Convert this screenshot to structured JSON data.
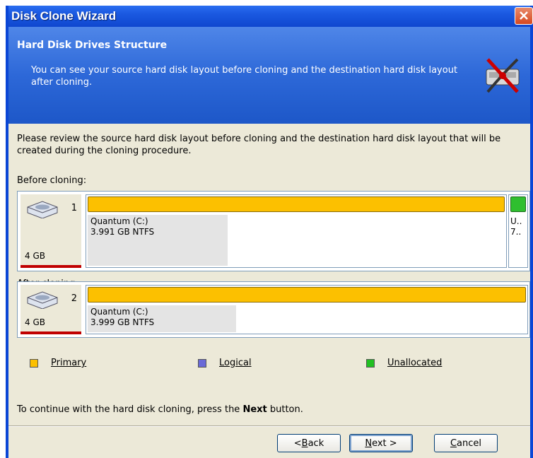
{
  "window": {
    "title": "Disk Clone Wizard"
  },
  "header": {
    "title": "Hard Disk Drives Structure",
    "description": "You can see your source hard disk layout before cloning and the destination hard disk layout after cloning."
  },
  "intro": "Please review the source hard disk layout before cloning and the destination hard disk layout that will be created during the cloning procedure.",
  "before": {
    "label": "Before cloning:",
    "disk_number": "1",
    "disk_size": "4 GB",
    "partitions": [
      {
        "name": "Quantum (C:)",
        "details": "3.991 GB  NTFS",
        "type": "Primary",
        "used_fraction": 0.34
      },
      {
        "name": "U..",
        "details": "7..",
        "type": "Unallocated"
      }
    ]
  },
  "after": {
    "label": "After cloning:",
    "disk_number": "2",
    "disk_size": "4 GB",
    "partitions": [
      {
        "name": "Quantum (C:)",
        "details": "3.999 GB  NTFS",
        "type": "Primary",
        "used_fraction": 0.34
      }
    ]
  },
  "legend": {
    "primary": "Primary",
    "logical": "Logical",
    "unallocated": "Unallocated",
    "colors": {
      "primary": "#fcc000",
      "logical": "#6a6ad8",
      "unallocated": "#22c022"
    }
  },
  "footer": {
    "text_before": "To continue with the hard disk cloning, press the ",
    "text_bold": "Next",
    "text_after": " button."
  },
  "buttons": {
    "back_pre": "< ",
    "back_ul": "B",
    "back_post": "ack",
    "next_ul": "N",
    "next_post": "ext >",
    "cancel_ul": "C",
    "cancel_post": "ancel"
  }
}
